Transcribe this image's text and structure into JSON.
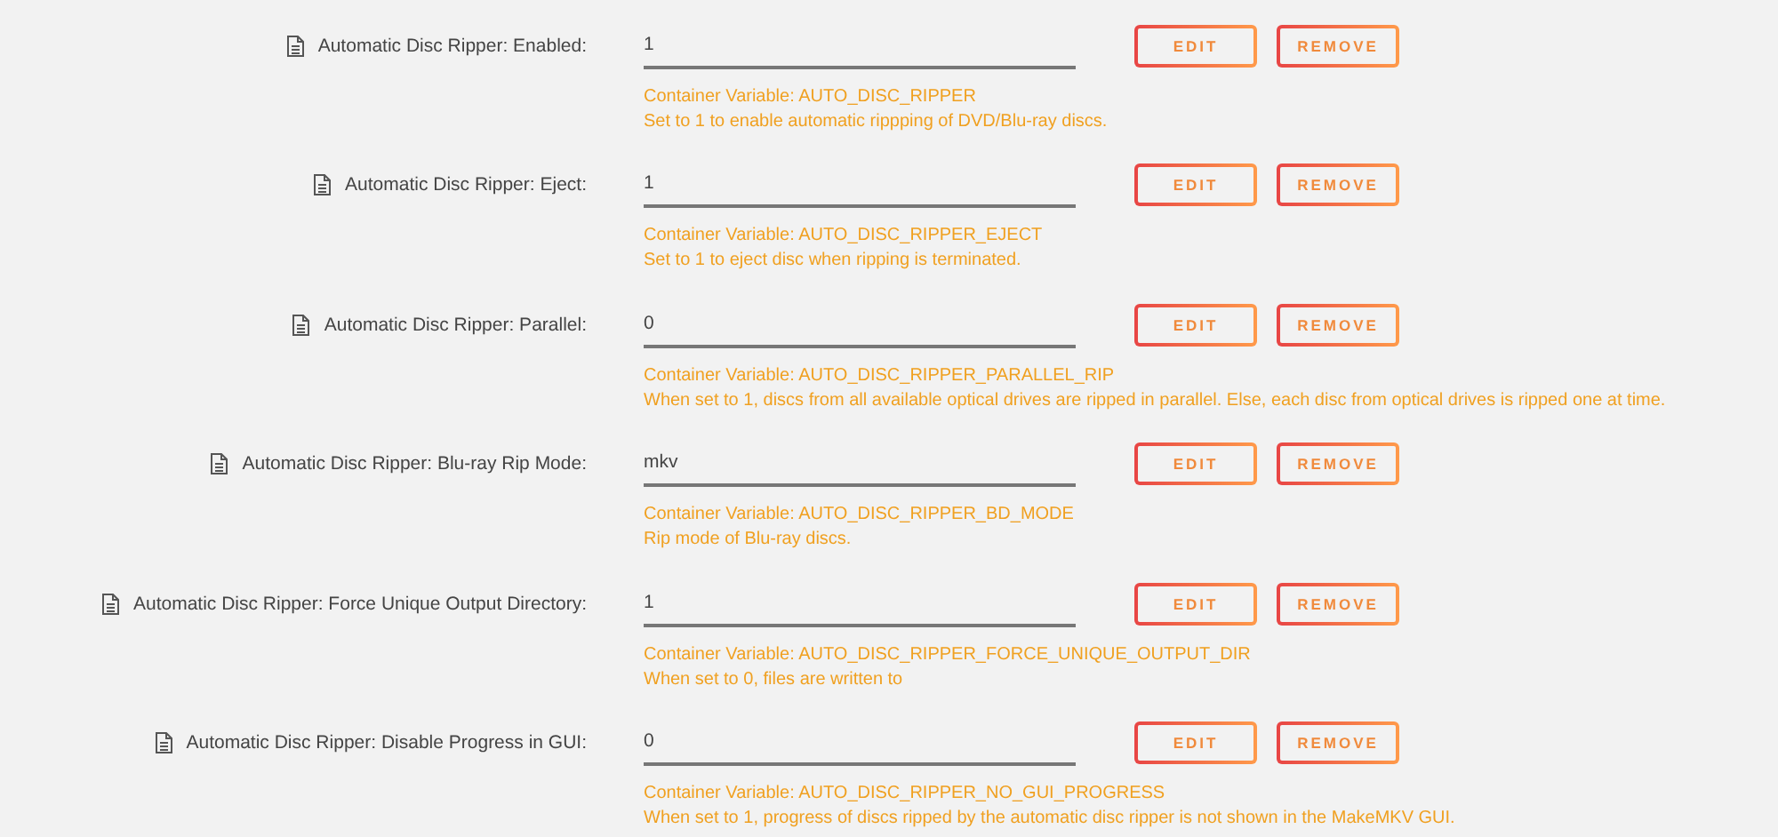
{
  "settings": [
    {
      "label": "Automatic Disc Ripper: Enabled:",
      "value": "1",
      "variable": "Container Variable: AUTO_DISC_RIPPER",
      "description": "Set to 1 to enable automatic rippping of DVD/Blu-ray discs.",
      "buttons": [
        "EDIT",
        "REMOVE"
      ]
    },
    {
      "label": "Automatic Disc Ripper: Eject:",
      "value": "1",
      "variable": "Container Variable: AUTO_DISC_RIPPER_EJECT",
      "description": "Set to 1 to eject disc when ripping is terminated.",
      "buttons": [
        "EDIT",
        "REMOVE"
      ]
    },
    {
      "label": "Automatic Disc Ripper: Parallel:",
      "value": "0",
      "variable": "Container Variable: AUTO_DISC_RIPPER_PARALLEL_RIP",
      "description": "When set to 1, discs from all available optical drives are ripped in parallel. Else, each disc from optical drives is ripped one at time.",
      "buttons": [
        "EDIT",
        "REMOVE"
      ]
    },
    {
      "label": "Automatic Disc Ripper: Blu-ray Rip Mode:",
      "value": "mkv",
      "variable": "Container Variable: AUTO_DISC_RIPPER_BD_MODE",
      "description": "Rip mode of Blu-ray discs.",
      "buttons": [
        "EDIT",
        "REMOVE"
      ]
    },
    {
      "label": "Automatic Disc Ripper: Force Unique Output Directory:",
      "value": "1",
      "variable": "Container Variable: AUTO_DISC_RIPPER_FORCE_UNIQUE_OUTPUT_DIR",
      "description": "When set to 0, files are written to",
      "buttons": [
        "EDIT",
        "REMOVE"
      ]
    },
    {
      "label": "Automatic Disc Ripper: Disable Progress in GUI:",
      "value": "0",
      "variable": "Container Variable: AUTO_DISC_RIPPER_NO_GUI_PROGRESS",
      "description": "When set to 1, progress of discs ripped by the automatic disc ripper is not shown in the MakeMKV GUI.",
      "buttons": [
        "EDIT",
        "REMOVE"
      ]
    }
  ]
}
